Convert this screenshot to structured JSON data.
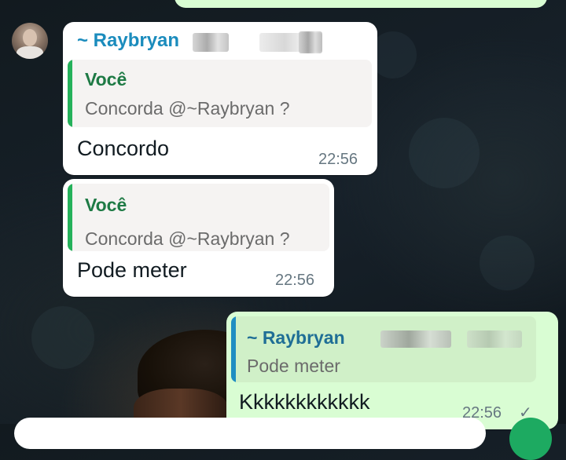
{
  "messages": [
    {
      "sender": "~ Raybryan",
      "quote": {
        "author": "Você",
        "text": "Concorda @~Raybryan ?"
      },
      "text": "Concordo",
      "time": "22:56"
    },
    {
      "quote": {
        "author": "Você",
        "text": "Concorda @~Raybryan ?"
      },
      "text": "Pode meter",
      "time": "22:56"
    },
    {
      "quote": {
        "author": "~ Raybryan",
        "text": "Pode meter"
      },
      "text": "Kkkkkkkkkkkk",
      "time": "22:56"
    }
  ],
  "colors": {
    "incoming_bubble": "#ffffff",
    "outgoing_bubble": "#d9fdd3",
    "quote_bar_self": "#25b15b",
    "quote_bar_other": "#1f8ec2",
    "sender_name": "#1f8ec2",
    "send_button": "#1daa61"
  },
  "icons": {
    "avatar": "contact-avatar",
    "delivered": "check-icon"
  }
}
